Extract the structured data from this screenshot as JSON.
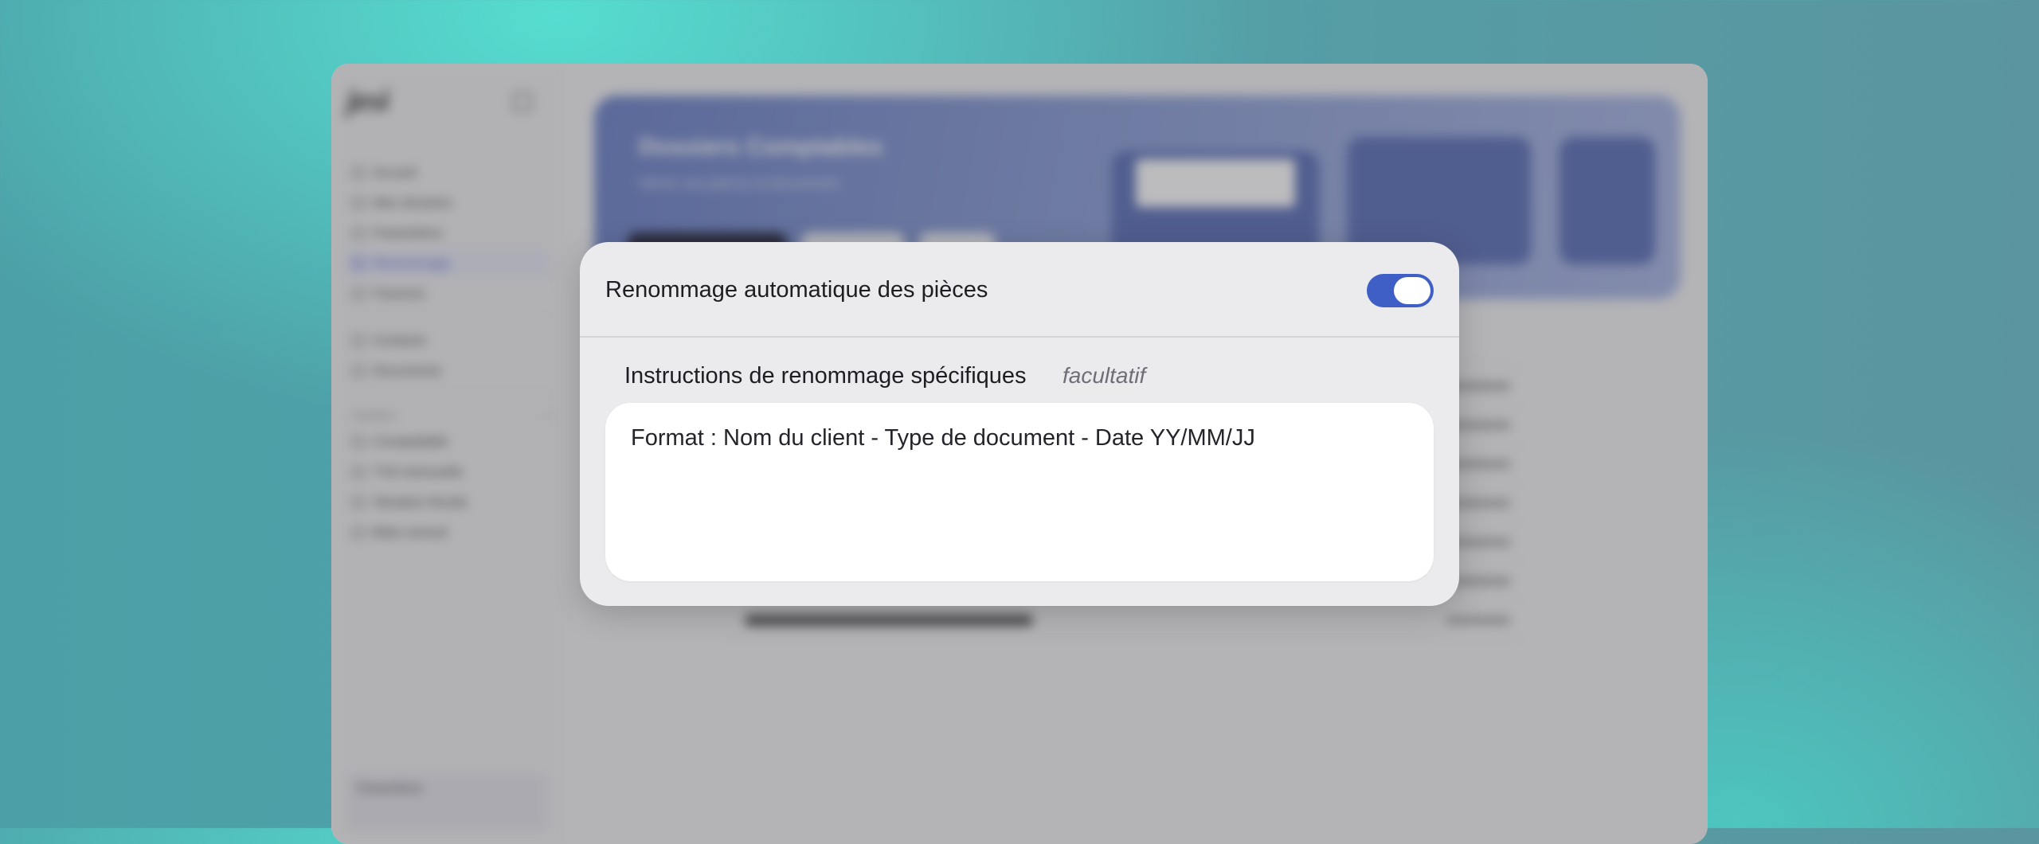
{
  "background_app": {
    "logo_text": "jesi",
    "sidebar": {
      "items": [
        {
          "label": "Accueil"
        },
        {
          "label": "Mes dossiers"
        },
        {
          "label": "Paramètres"
        },
        {
          "label": "Renommage",
          "active": true
        },
        {
          "label": "Factures"
        }
      ],
      "secondary_items": [
        {
          "label": "Contacts"
        },
        {
          "label": "Documents"
        }
      ],
      "section_title": "Dossiers",
      "section_items": [
        {
          "label": "Comptabilité"
        },
        {
          "label": "TVA mensuelle"
        },
        {
          "label": "Situation fiscale"
        },
        {
          "label": "Bilan annuel"
        }
      ],
      "footer_text": "Paramètres"
    },
    "banner": {
      "title": "Dossiers Comptables",
      "subtitle": "Gérez vos pièces et documents"
    }
  },
  "modal": {
    "title": "Renommage automatique des pièces",
    "toggle_enabled": true,
    "field_label": "Instructions de renommage spécifiques",
    "field_optional": "facultatif",
    "field_value": "Format : Nom du client - Type de document - Date YY/MM/JJ"
  },
  "colors": {
    "accent": "#3f5fc6",
    "modal_bg": "#ebebed",
    "field_bg": "#ffffff"
  }
}
